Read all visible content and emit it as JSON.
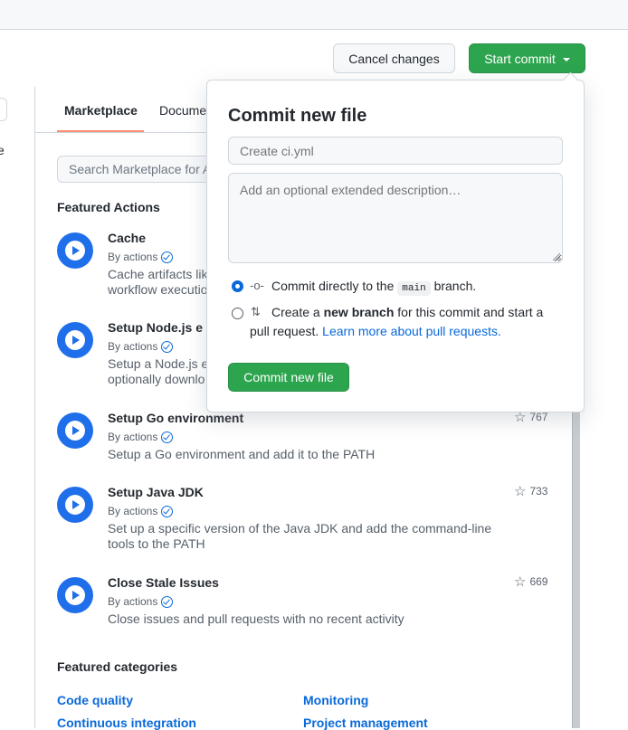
{
  "header": {
    "cancel_label": "Cancel changes",
    "start_commit_label": "Start commit"
  },
  "left": {
    "letter": "e"
  },
  "tabs": [
    {
      "label": "Marketplace",
      "active": true
    },
    {
      "label": "Docume"
    }
  ],
  "search": {
    "placeholder": "Search Marketplace for A"
  },
  "featured_actions": {
    "title": "Featured Actions",
    "items": [
      {
        "name": "Cache",
        "by": "By actions",
        "desc": "Cache artifacts lik",
        "desc2": "workflow executio",
        "stars": ""
      },
      {
        "name": "Setup Node.js e",
        "by": "By actions",
        "desc": "Setup a Node.js e",
        "desc2": "optionally downlo",
        "stars": ""
      },
      {
        "name": "Setup Go environment",
        "by": "By actions",
        "desc": "Setup a Go environment and add it to the PATH",
        "desc2": "",
        "stars": "767"
      },
      {
        "name": "Setup Java JDK",
        "by": "By actions",
        "desc": "Set up a specific version of the Java JDK and add the command-line",
        "desc2": "tools to the PATH",
        "stars": "733"
      },
      {
        "name": "Close Stale Issues",
        "by": "By actions",
        "desc": "Close issues and pull requests with no recent activity",
        "desc2": "",
        "stars": "669"
      }
    ]
  },
  "featured_categories": {
    "title": "Featured categories",
    "links": [
      "Code quality",
      "Monitoring",
      "Continuous integration",
      "Project management"
    ]
  },
  "popover": {
    "title": "Commit new file",
    "filename_placeholder": "Create ci.yml",
    "description_placeholder": "Add an optional extended description…",
    "option_direct_pre": "Commit directly to the",
    "branch": "main",
    "option_direct_post": "branch.",
    "option_new_pre": "Create a",
    "option_new_bold": "new branch",
    "option_new_post": "for this commit and start a",
    "option_new_line2": "pull request.",
    "learn_more": "Learn more about pull requests.",
    "commit_button": "Commit new file"
  },
  "colors": {
    "accent_green": "#2da44e",
    "link_blue": "#0969da",
    "play_blue": "#1f6feb"
  }
}
